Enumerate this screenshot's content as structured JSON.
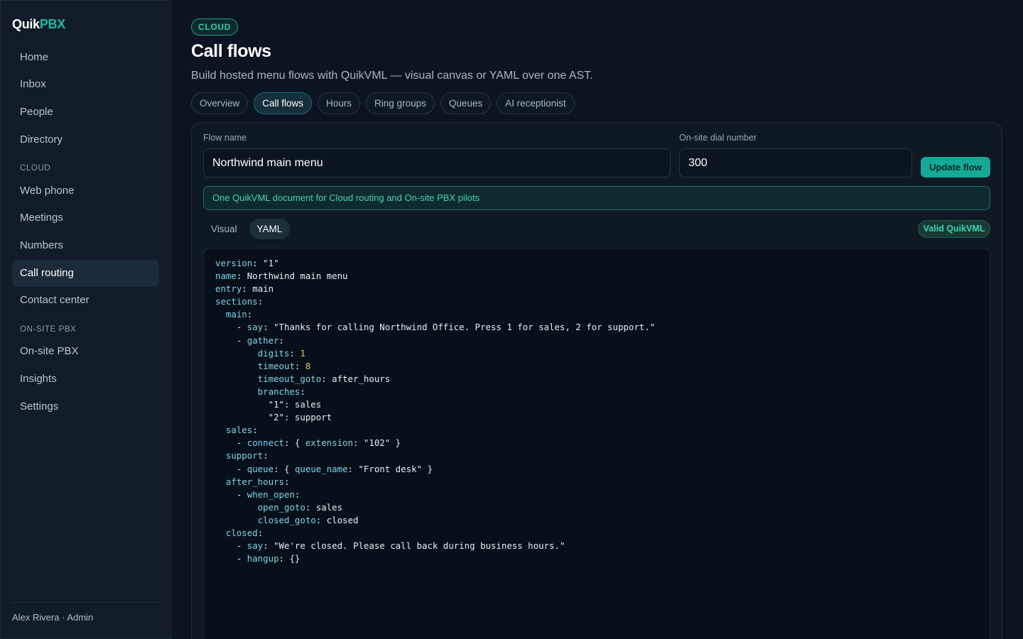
{
  "app": {
    "logo_part1": "Quik",
    "logo_part2": "PBX"
  },
  "sidebar": {
    "items": [
      {
        "label": "Home"
      },
      {
        "label": "Inbox"
      },
      {
        "label": "People"
      },
      {
        "label": "Directory"
      },
      {
        "label": "Web phone"
      },
      {
        "label": "Meetings"
      },
      {
        "label": "Numbers"
      },
      {
        "label": "Call routing",
        "active": true
      },
      {
        "label": "Contact center"
      },
      {
        "label": "On-site PBX"
      },
      {
        "label": "Insights"
      },
      {
        "label": "Settings"
      }
    ],
    "sections": {
      "cloud": "CLOUD",
      "onsite": "ON-SITE PBX"
    },
    "user": "Alex Rivera · Admin"
  },
  "header": {
    "badge": "CLOUD",
    "title": "Call flows",
    "subtitle": "Build hosted menu flows with QuikVML — visual canvas or YAML over one AST."
  },
  "tabs": [
    {
      "label": "Overview"
    },
    {
      "label": "Call flows",
      "active": true
    },
    {
      "label": "Hours"
    },
    {
      "label": "Ring groups"
    },
    {
      "label": "Queues"
    },
    {
      "label": "AI receptionist"
    }
  ],
  "form": {
    "flow_name_label": "Flow name",
    "flow_name_value": "Northwind main menu",
    "dial_number_label": "On-site dial number",
    "dial_number_value": "300",
    "update_button": "Update flow"
  },
  "banner": "One QuikVML document for Cloud routing and On-site PBX pilots",
  "editor": {
    "modes": [
      {
        "label": "Visual"
      },
      {
        "label": "YAML",
        "active": true
      }
    ],
    "status": "Valid QuikVML",
    "yaml_lines": [
      "version: \"1\"",
      "name: Northwind main menu",
      "entry: main",
      "sections:",
      "  main:",
      "    - say: \"Thanks for calling Northwind Office. Press 1 for sales, 2 for support.\"",
      "    - gather:",
      "        digits: 1",
      "        timeout: 8",
      "        timeout_goto: after_hours",
      "        branches:",
      "          \"1\": sales",
      "          \"2\": support",
      "  sales:",
      "    - connect: { extension: \"102\" }",
      "  support:",
      "    - queue: { queue_name: \"Front desk\" }",
      "  after_hours:",
      "    - when_open:",
      "        open_goto: sales",
      "        closed_goto: closed",
      "  closed:",
      "    - say: \"We're closed. Please call back during business hours.\"",
      "    - hangup: {}"
    ]
  },
  "colors": {
    "accent": "#16a997",
    "background": "#0b1420",
    "sidebar": "#111c28"
  }
}
